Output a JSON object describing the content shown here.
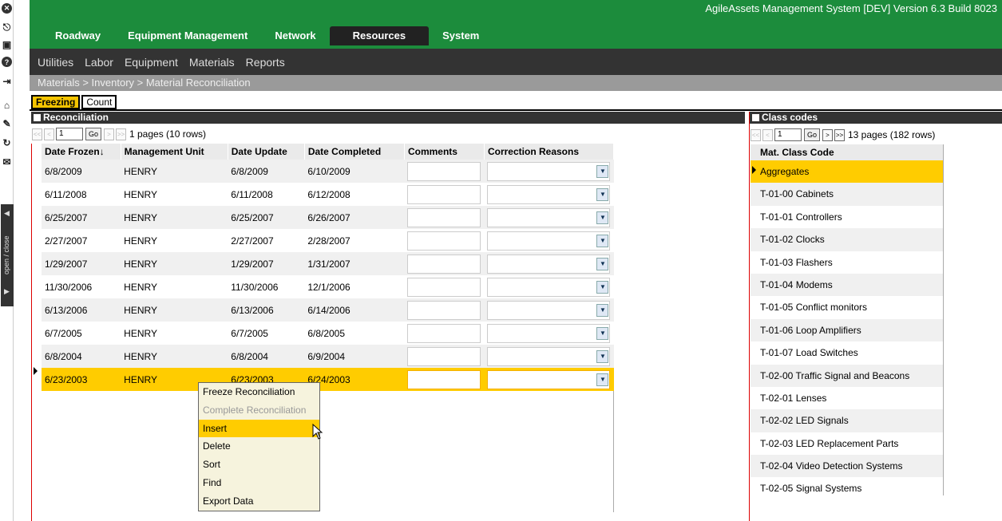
{
  "app": {
    "title": "AgileAssets Management System [DEV] Version 6.3 Build 8023"
  },
  "rail": {
    "icons": [
      "close-circle-icon",
      "logout-icon",
      "save-icon",
      "help-icon",
      "login-icon",
      "home-icon",
      "edit-icon",
      "refresh-icon",
      "mail-icon"
    ],
    "open_close": "open / close"
  },
  "main_tabs": [
    "Roadway",
    "Equipment Management",
    "Network",
    "Resources",
    "System"
  ],
  "active_main_tab": "Resources",
  "sub_menu": [
    "Utilities",
    "Labor",
    "Equipment",
    "Materials",
    "Reports"
  ],
  "breadcrumb": "Materials > Inventory > Material Reconciliation",
  "sub_tabs": [
    "Freezing",
    "Count"
  ],
  "reconciliation": {
    "title": "Reconciliation",
    "pager": {
      "page": "1",
      "go": "Go",
      "info": "1 pages (10 rows)"
    },
    "columns": [
      "Date Frozen",
      "Management Unit",
      "Date Update",
      "Date Completed",
      "Comments",
      "Correction Reasons"
    ],
    "sort_indicator": "↓",
    "rows": [
      [
        "6/8/2009",
        "HENRY",
        "6/8/2009",
        "6/10/2009"
      ],
      [
        "6/11/2008",
        "HENRY",
        "6/11/2008",
        "6/12/2008"
      ],
      [
        "6/25/2007",
        "HENRY",
        "6/25/2007",
        "6/26/2007"
      ],
      [
        "2/27/2007",
        "HENRY",
        "2/27/2007",
        "2/28/2007"
      ],
      [
        "1/29/2007",
        "HENRY",
        "1/29/2007",
        "1/31/2007"
      ],
      [
        "11/30/2006",
        "HENRY",
        "11/30/2006",
        "12/1/2006"
      ],
      [
        "6/13/2006",
        "HENRY",
        "6/13/2006",
        "6/14/2006"
      ],
      [
        "6/7/2005",
        "HENRY",
        "6/7/2005",
        "6/8/2005"
      ],
      [
        "6/8/2004",
        "HENRY",
        "6/8/2004",
        "6/9/2004"
      ],
      [
        "6/23/2003",
        "HENRY",
        "6/23/2003",
        "6/24/2003"
      ]
    ],
    "selected_row": 9
  },
  "context_menu": {
    "items": [
      "Freeze Reconciliation",
      "Complete Reconciliation",
      "Insert",
      "Delete",
      "Sort",
      "Find",
      "Export Data"
    ],
    "disabled": [
      1
    ],
    "highlighted": 2
  },
  "class_codes": {
    "title": "Class codes",
    "pager": {
      "page": "1",
      "go": "Go",
      "info": "13 pages (182 rows)"
    },
    "column": "Mat. Class Code",
    "items": [
      "Aggregates",
      "T-01-00 Cabinets",
      "T-01-01 Controllers",
      "T-01-02 Clocks",
      "T-01-03 Flashers",
      "T-01-04 Modems",
      "T-01-05 Conflict monitors",
      "T-01-06 Loop Amplifiers",
      "T-01-07 Load Switches",
      "T-02-00 Traffic Signal and Beacons",
      "T-02-01 Lenses",
      "T-02-02 LED Signals",
      "T-02-03 LED Replacement Parts",
      "T-02-04 Video Detection Systems",
      "T-02-05 Signal Systems"
    ],
    "selected": 0
  },
  "colors": {
    "header_green": "#1c8c3c",
    "dark_bar": "#333333",
    "selection": "#ffcc00",
    "breadcrumb": "#9a9a9a"
  }
}
